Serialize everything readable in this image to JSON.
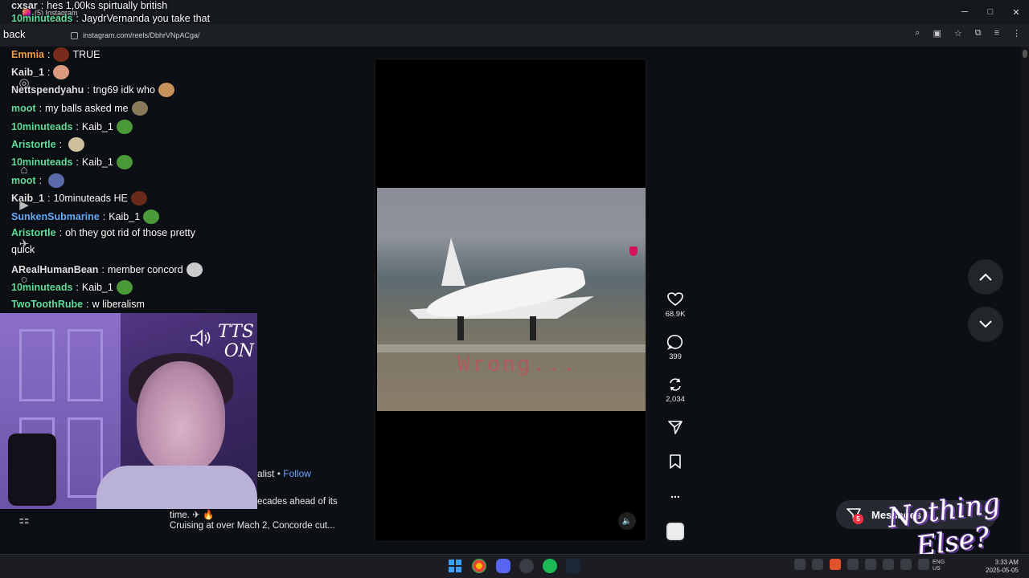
{
  "browser": {
    "tab_title": "(5) Instagram",
    "url": "instagram.com/reels/DbhrVNpACga/",
    "back_label": "back",
    "window_controls": [
      "minimize-icon",
      "maximize-icon",
      "close-icon"
    ],
    "toolbar_icons": [
      "zoom-icon",
      "extension-icon",
      "star-icon",
      "puzzle-icon",
      "media-icon",
      "menu-icon"
    ]
  },
  "chat": {
    "lines": [
      {
        "user": "cxsar",
        "user_color": "#e0e0e0",
        "text": "hes 1,00ks spirtually british"
      },
      {
        "user": "10minuteads",
        "user_color": "#5fe0a0",
        "text": "JaydrVernanda you take that"
      },
      {
        "user": "Emmia",
        "user_color": "#f0a040",
        "text": "TRUE"
      },
      {
        "user": "Kaib_1",
        "user_color": "#e0e0e0",
        "text": ""
      },
      {
        "user": "Nettspendyahu",
        "user_color": "#e0e0e0",
        "text": "tng69 idk who"
      },
      {
        "user": "moot",
        "user_color": "#5fe0a0",
        "text": "my balls asked me"
      },
      {
        "user": "10minuteads",
        "user_color": "#5fe0a0",
        "text": "Kaib_1"
      },
      {
        "user": "Aristortle",
        "user_color": "#5fe0a0",
        "text": ""
      },
      {
        "user": "10minuteads",
        "user_color": "#5fe0a0",
        "text": "Kaib_1"
      },
      {
        "user": "moot",
        "user_color": "#5fe0a0",
        "text": ""
      },
      {
        "user": "Kaib_1",
        "user_color": "#e0e0e0",
        "text": "10minuteads HE"
      },
      {
        "user": "SunkenSubmarine",
        "user_color": "#60b0ff",
        "text": "Kaib_1"
      },
      {
        "user": "Aristortle",
        "user_color": "#5fe0a0",
        "text": "oh they got rid of those pretty"
      },
      {
        "user": "",
        "user_color": "#e0e0e0",
        "text": "quick"
      },
      {
        "user": "ARealHumanBean",
        "user_color": "#e0e0e0",
        "text": "member concord"
      },
      {
        "user": "10minuteads",
        "user_color": "#5fe0a0",
        "text": "Kaib_1"
      },
      {
        "user": "TwoToothRube",
        "user_color": "#5fe0a0",
        "text": "w liberalism"
      }
    ]
  },
  "webcam": {
    "tts_text": "TTS ON"
  },
  "reel": {
    "caption_word": "Wrong...",
    "author_suffix": "alist",
    "follow_separator": "•",
    "follow_label": "Follow",
    "desc_line1": "ecades ahead of its",
    "desc_line2": "time. ✈ 🔥",
    "desc_line3": "Cruising at over Mach 2, Concorde cut...",
    "actions": [
      {
        "name": "like",
        "icon": "heart-icon",
        "count": "68.9K"
      },
      {
        "name": "comment",
        "icon": "comment-icon",
        "count": "399"
      },
      {
        "name": "repost",
        "icon": "repost-icon",
        "count": "2,034"
      },
      {
        "name": "share",
        "icon": "send-icon",
        "count": ""
      },
      {
        "name": "save",
        "icon": "bookmark-icon",
        "count": ""
      },
      {
        "name": "more",
        "icon": "more-icon",
        "count": "..."
      }
    ]
  },
  "messages": {
    "label": "Messages",
    "badge": "5"
  },
  "overlay": {
    "brand_text_line1": "Nothing",
    "brand_text_line2": "Else?"
  },
  "taskbar": {
    "lang_line1": "ENG",
    "lang_line2": "US",
    "time": "3:33 AM",
    "date": "2025-05-05"
  }
}
